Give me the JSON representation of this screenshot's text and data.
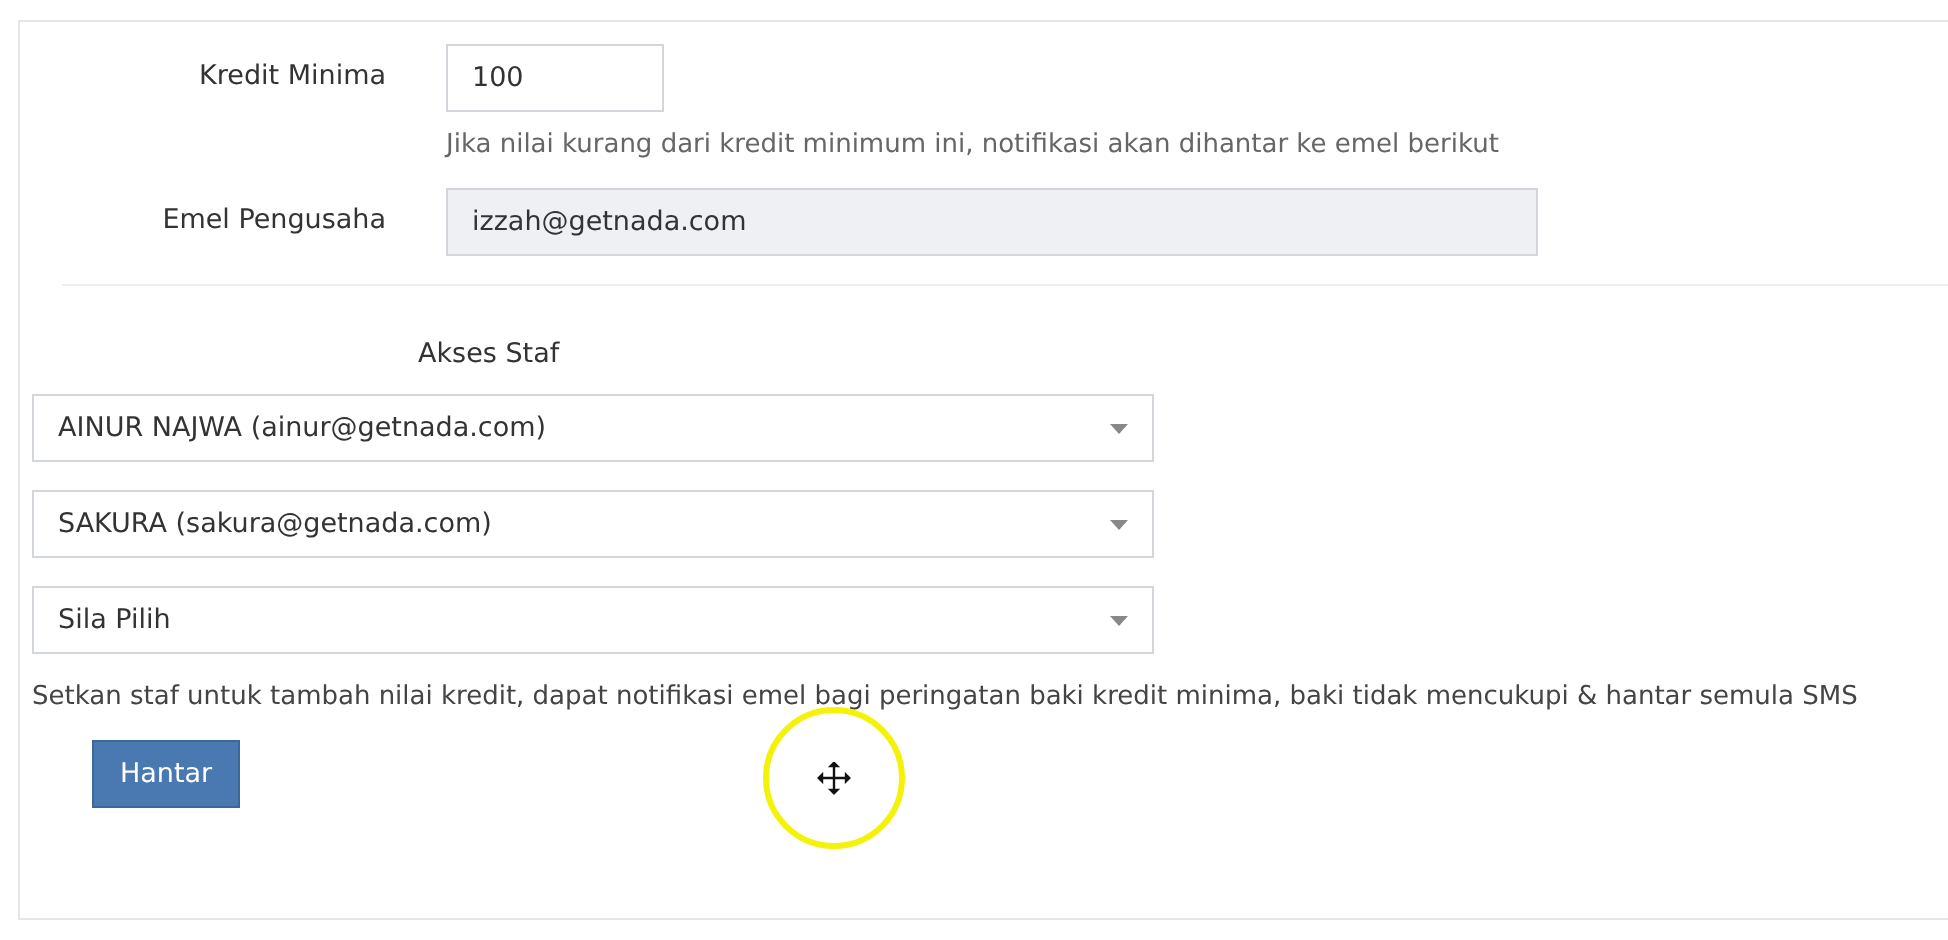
{
  "fields": [
    {
      "label": "Kredit Minima",
      "value": "100",
      "kind": "input",
      "hint": "Jika nilai kurang dari kredit minimum ini, notifikasi akan dihantar ke emel berikut"
    },
    {
      "label": "Emel Pengusaha",
      "value": "izzah@getnada.com",
      "kind": "readonly"
    }
  ],
  "staff_access": {
    "title": "Akses Staf",
    "selects": [
      {
        "value": "AINUR NAJWA (ainur@getnada.com)"
      },
      {
        "value": "SAKURA (sakura@getnada.com)"
      },
      {
        "value": "Sila Pilih"
      }
    ],
    "help": "Setkan staf untuk tambah nilai kredit, dapat notifikasi emel bagi peringatan baki kredit minima, baki tidak mencukupi & hantar semula SMS"
  },
  "submit": "Hantar"
}
